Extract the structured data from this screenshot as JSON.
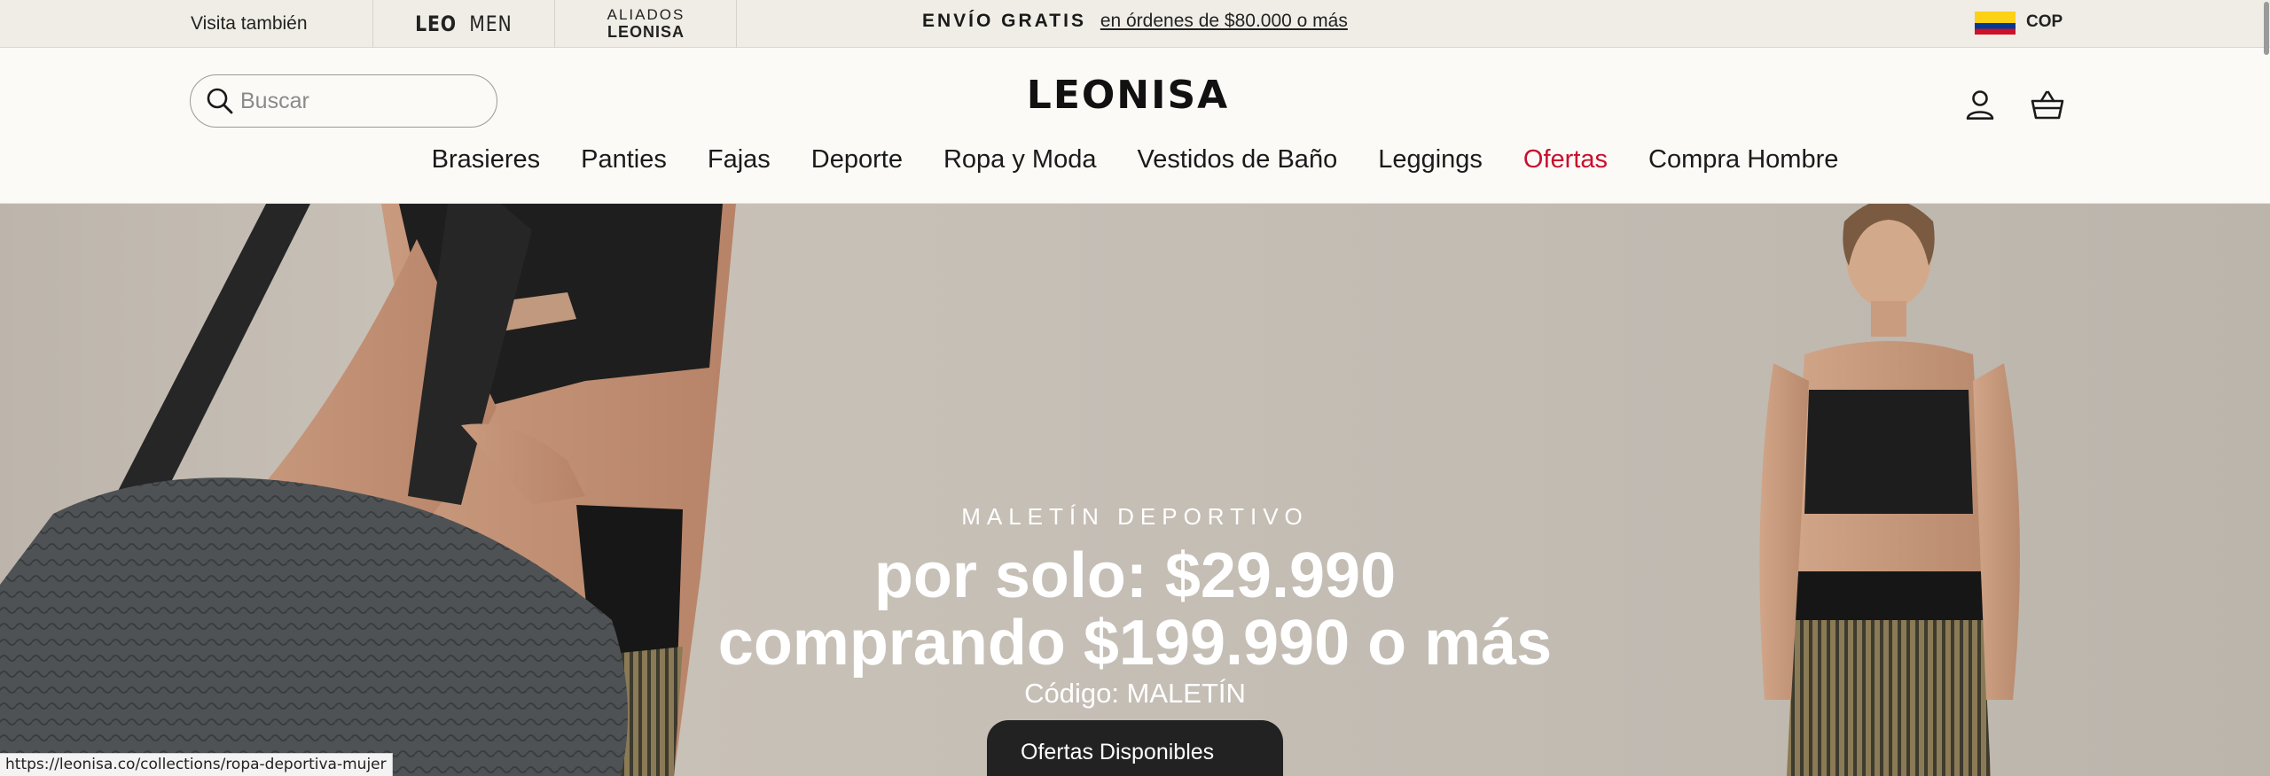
{
  "topbar": {
    "visit_label": "Visita también",
    "leomen_leo": "LEO",
    "leomen_men": "MEN",
    "aliados_top": "ALIADOS",
    "aliados_bottom": "LEONISA",
    "promo_bold": "ENVÍO GRATIS",
    "promo_link": "en órdenes de $80.000 o más",
    "currency": "COP",
    "flag_colors": [
      "#fcd116",
      "#003893",
      "#ce1126"
    ]
  },
  "header": {
    "search_placeholder": "Buscar",
    "logo": "LEONISA",
    "account_icon": "user-icon",
    "cart_icon": "basket-icon"
  },
  "nav": {
    "items": [
      {
        "label": "Brasieres"
      },
      {
        "label": "Panties"
      },
      {
        "label": "Fajas"
      },
      {
        "label": "Deporte"
      },
      {
        "label": "Ropa y Moda"
      },
      {
        "label": "Vestidos de Baño"
      },
      {
        "label": "Leggings"
      },
      {
        "label": "Ofertas",
        "accent": "#c8102e"
      },
      {
        "label": "Compra Hombre"
      }
    ]
  },
  "hero": {
    "eyebrow": "MALETÍN DEPORTIVO",
    "line1": "por solo: $29.990",
    "line2": "comprando $199.990 o más",
    "code": "Código: MALETÍN",
    "offers_button": "Ofertas Disponibles"
  },
  "status": {
    "url": "https://leonisa.co/collections/ropa-deportiva-mujer"
  }
}
